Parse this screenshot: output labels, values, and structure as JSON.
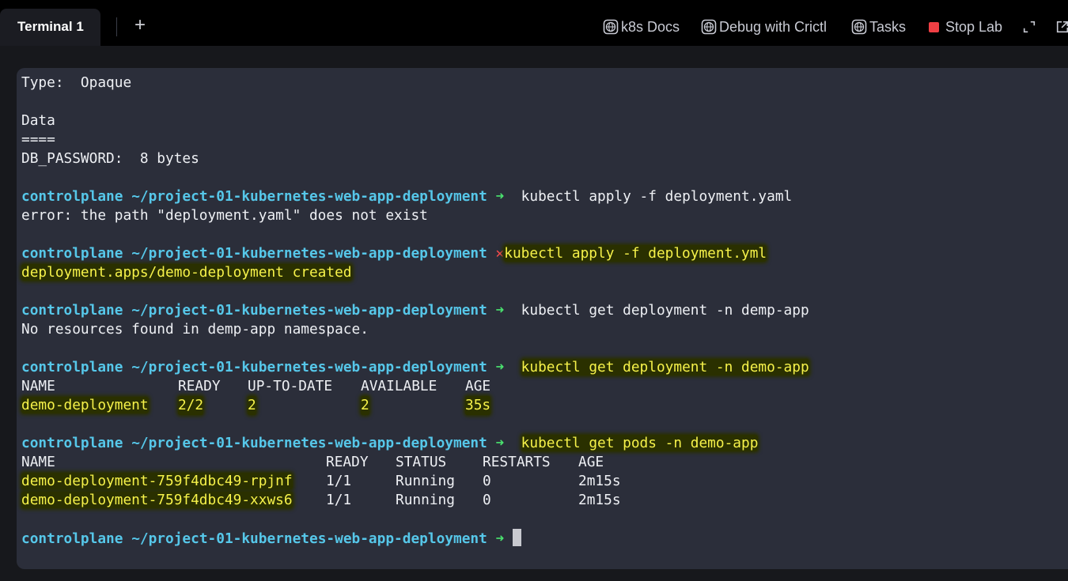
{
  "tabs": [
    {
      "label": "Terminal 1"
    }
  ],
  "toolbar": {
    "new_tab": "+",
    "docs": "k8s Docs",
    "debug": "Debug with Crictl",
    "tasks": "Tasks",
    "stop": "Stop Lab"
  },
  "colors": {
    "prompt": "#56c7e9",
    "arrow": "#4ae36f",
    "error_x": "#ff4c4c",
    "highlight_text": "#f6f24a",
    "terminal_bg": "#2b2e3a",
    "stop": "#ef3f44"
  },
  "prompt": {
    "host": "controlplane",
    "path": "~/project-01-kubernetes-web-app-deployment",
    "arrow": "➜",
    "error_mark": "✕"
  },
  "terminal": {
    "secret": {
      "type": "Type:  Opaque",
      "data": "Data",
      "sep": "====",
      "pw": "DB_PASSWORD:  8 bytes"
    },
    "cmd1": {
      "text": "kubectl apply -f deployment.yaml",
      "out": "error: the path \"deployment.yaml\" does not exist"
    },
    "cmd2": {
      "text": "kubectl apply -f deployment.yml",
      "out": "deployment.apps/demo-deployment created"
    },
    "cmd3": {
      "text": "kubectl get deployment -n demp-app",
      "out": "No resources found in demp-app namespace."
    },
    "cmd4": {
      "text": "kubectl get deployment -n demo-app",
      "headers": {
        "name": "NAME",
        "ready": "READY",
        "uptodate": "UP-TO-DATE",
        "available": "AVAILABLE",
        "age": "AGE"
      },
      "row": {
        "name": "demo-deployment",
        "ready": "2/2",
        "uptodate": "2",
        "available": "2",
        "age": "35s"
      }
    },
    "cmd5": {
      "text": "kubectl get pods -n demo-app",
      "headers": {
        "name": "NAME",
        "ready": "READY",
        "status": "STATUS",
        "restarts": "RESTARTS",
        "age": "AGE"
      },
      "rows": [
        {
          "name": "demo-deployment-759f4dbc49-rpjnf",
          "ready": "1/1",
          "status": "Running",
          "restarts": "0",
          "age": "2m15s"
        },
        {
          "name": "demo-deployment-759f4dbc49-xxws6",
          "ready": "1/1",
          "status": "Running",
          "restarts": "0",
          "age": "2m15s"
        }
      ]
    }
  }
}
